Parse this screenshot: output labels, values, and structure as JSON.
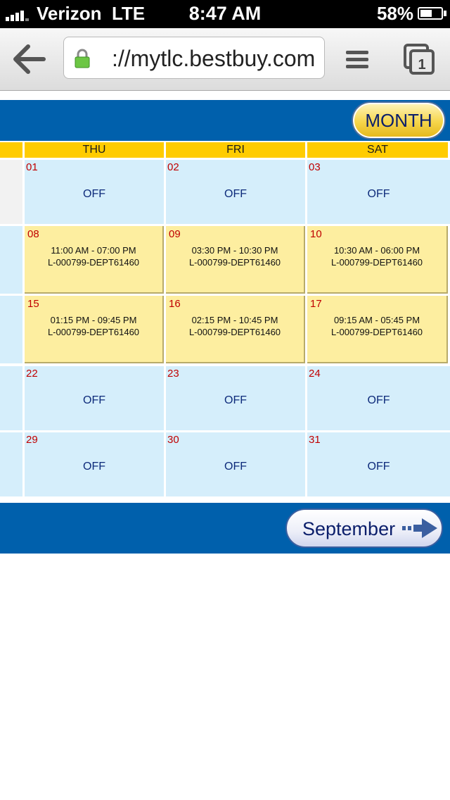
{
  "status_bar": {
    "carrier": "Verizon",
    "network": "LTE",
    "time": "8:47 AM",
    "battery": "58%",
    "battery_level": 0.58
  },
  "browser": {
    "url": "://mytlc.bestbuy.com",
    "tab_count": "1"
  },
  "calendar": {
    "view_button": "MONTH",
    "next_month_button": "September",
    "day_headers": [
      "THU",
      "FRI",
      "SAT"
    ],
    "weeks": [
      {
        "days": [
          {
            "date": "01",
            "status": "OFF"
          },
          {
            "date": "02",
            "status": "OFF"
          },
          {
            "date": "03",
            "status": "OFF"
          }
        ]
      },
      {
        "days": [
          {
            "date": "08",
            "shift": "11:00 AM - 07:00 PM",
            "dept": "L-000799-DEPT61460"
          },
          {
            "date": "09",
            "shift": "03:30 PM - 10:30 PM",
            "dept": "L-000799-DEPT61460"
          },
          {
            "date": "10",
            "shift": "10:30 AM - 06:00 PM",
            "dept": "L-000799-DEPT61460"
          }
        ]
      },
      {
        "days": [
          {
            "date": "15",
            "shift": "01:15 PM - 09:45 PM",
            "dept": "L-000799-DEPT61460"
          },
          {
            "date": "16",
            "shift": "02:15 PM - 10:45 PM",
            "dept": "L-000799-DEPT61460"
          },
          {
            "date": "17",
            "shift": "09:15 AM - 05:45 PM",
            "dept": "L-000799-DEPT61460"
          }
        ]
      },
      {
        "days": [
          {
            "date": "22",
            "status": "OFF"
          },
          {
            "date": "23",
            "status": "OFF"
          },
          {
            "date": "24",
            "status": "OFF"
          }
        ]
      },
      {
        "days": [
          {
            "date": "29",
            "status": "OFF"
          },
          {
            "date": "30",
            "status": "OFF"
          },
          {
            "date": "31",
            "status": "OFF"
          }
        ]
      }
    ]
  },
  "colors": {
    "header_blue": "#0060ac",
    "day_header_yellow": "#ffcc00",
    "off_cell": "#d5eefb",
    "work_cell": "#fdeea0",
    "date_red": "#c00000"
  }
}
